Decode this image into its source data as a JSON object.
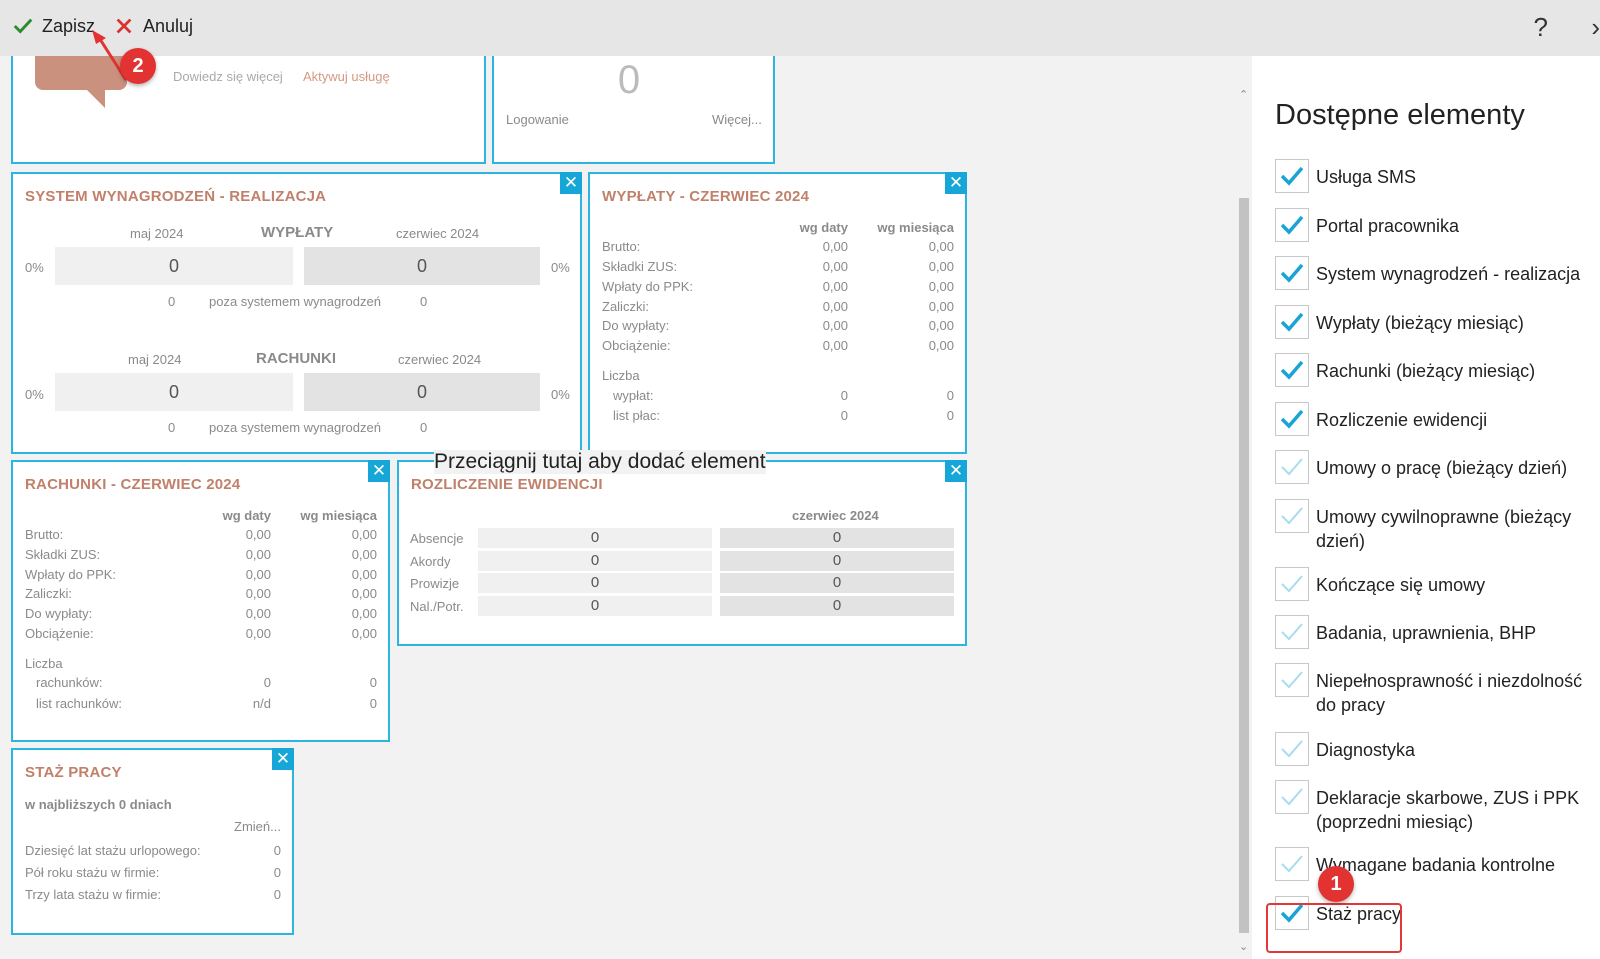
{
  "toolbar": {
    "save_label": "Zapisz",
    "cancel_label": "Anuluj",
    "help_label": "?",
    "next_label": "›"
  },
  "partial_top": {
    "left_text": "Dowiedz się więcej",
    "left_link": "Aktywuj usługę",
    "right_value": "0",
    "right_label": "Logowanie",
    "right_more": "Więcej..."
  },
  "system_wynagrodzen": {
    "title": "SYSTEM WYNAGRODZEŃ - REALIZACJA",
    "wyplaty": {
      "heading": "WYPŁATY",
      "left_month": "maj 2024",
      "right_month": "czerwiec 2024",
      "left_pct": "0%",
      "right_pct": "0%",
      "left_value": "0",
      "right_value": "0",
      "left_outside": "0",
      "right_outside": "0",
      "outside_label": "poza systemem wynagrodzeń"
    },
    "rachunki": {
      "heading": "RACHUNKI",
      "left_month": "maj 2024",
      "right_month": "czerwiec 2024",
      "left_pct": "0%",
      "right_pct": "0%",
      "left_value": "0",
      "right_value": "0",
      "left_outside": "0",
      "right_outside": "0",
      "outside_label": "poza systemem wynagrodzeń"
    }
  },
  "wyplaty_panel": {
    "title": "WYPŁATY - CZERWIEC 2024",
    "col_date": "wg daty",
    "col_month": "wg miesiąca",
    "rows": [
      {
        "label": "Brutto:",
        "date": "0,00",
        "month": "0,00"
      },
      {
        "label": "Składki ZUS:",
        "date": "0,00",
        "month": "0,00"
      },
      {
        "label": "Wpłaty do PPK:",
        "date": "0,00",
        "month": "0,00"
      },
      {
        "label": "Zaliczki:",
        "date": "0,00",
        "month": "0,00"
      },
      {
        "label": "Do wypłaty:",
        "date": "0,00",
        "month": "0,00"
      },
      {
        "label": "Obciążenie:",
        "date": "0,00",
        "month": "0,00"
      }
    ],
    "count_label": "Liczba",
    "counts": [
      {
        "label": "wypłat:",
        "date": "0",
        "month": "0"
      },
      {
        "label": "list płac:",
        "date": "0",
        "month": "0"
      }
    ]
  },
  "rachunki_panel": {
    "title": "RACHUNKI - CZERWIEC 2024",
    "col_date": "wg daty",
    "col_month": "wg miesiąca",
    "rows": [
      {
        "label": "Brutto:",
        "date": "0,00",
        "month": "0,00"
      },
      {
        "label": "Składki ZUS:",
        "date": "0,00",
        "month": "0,00"
      },
      {
        "label": "Wpłaty do PPK:",
        "date": "0,00",
        "month": "0,00"
      },
      {
        "label": "Zaliczki:",
        "date": "0,00",
        "month": "0,00"
      },
      {
        "label": "Do wypłaty:",
        "date": "0,00",
        "month": "0,00"
      },
      {
        "label": "Obciążenie:",
        "date": "0,00",
        "month": "0,00"
      }
    ],
    "count_label": "Liczba",
    "counts": [
      {
        "label": "rachunków:",
        "date": "0",
        "month": "0"
      },
      {
        "label": "list rachunków:",
        "date": "n/d",
        "month": "0"
      }
    ]
  },
  "rozliczenie_panel": {
    "title": "ROZLICZENIE EWIDENCJI",
    "month": "czerwiec 2024",
    "rows": [
      {
        "label": "Absencje",
        "left": "0",
        "right": "0"
      },
      {
        "label": "Akordy",
        "left": "0",
        "right": "0"
      },
      {
        "label": "Prowizje",
        "left": "0",
        "right": "0"
      },
      {
        "label": "Nal./Potr.",
        "left": "0",
        "right": "0"
      }
    ]
  },
  "staz_panel": {
    "title": "STAŻ PRACY",
    "subtitle": "w najbliższych 0 dniach",
    "change_link": "Zmień...",
    "rows": [
      {
        "label": "Dziesięć lat stażu urlopowego:",
        "value": "0"
      },
      {
        "label": "Pół roku stażu w firmie:",
        "value": "0"
      },
      {
        "label": "Trzy lata stażu w firmie:",
        "value": "0"
      }
    ]
  },
  "drop_zone_label": "Przeciągnij tutaj aby dodać element",
  "sidebar": {
    "title": "Dostępne elementy",
    "items": [
      {
        "label": "Usługa SMS",
        "checked": true
      },
      {
        "label": "Portal pracownika",
        "checked": true
      },
      {
        "label": "System wynagrodzeń - realizacja",
        "checked": true
      },
      {
        "label": "Wypłaty (bieżący miesiąc)",
        "checked": true
      },
      {
        "label": "Rachunki (bieżący miesiąc)",
        "checked": true
      },
      {
        "label": "Rozliczenie ewidencji",
        "checked": true
      },
      {
        "label": "Umowy o pracę (bieżący dzień)",
        "checked": false
      },
      {
        "label": "Umowy cywilnoprawne (bieżący dzień)",
        "checked": false
      },
      {
        "label": "Kończące się umowy",
        "checked": false
      },
      {
        "label": "Badania, uprawnienia, BHP",
        "checked": false
      },
      {
        "label": "Niepełnosprawność i niezdolność do pracy",
        "checked": false
      },
      {
        "label": "Diagnostyka",
        "checked": false
      },
      {
        "label": "Deklaracje skarbowe, ZUS i PPK (poprzedni miesiąc)",
        "checked": false
      },
      {
        "label": "Wymagane badania kontrolne",
        "checked": false
      },
      {
        "label": "Staż pracy",
        "checked": true
      }
    ]
  },
  "annotations": {
    "step1": "1",
    "step2": "2"
  },
  "colors": {
    "accent": "#16a7d8",
    "panel_border": "#2bb5e0",
    "title_color": "#c1806a",
    "checked_mark": "#1aa4d6",
    "unchecked_mark": "#a8dcef",
    "step_badge": "#e23232",
    "save_check": "#2e8b2e",
    "cancel_x": "#d93030"
  }
}
